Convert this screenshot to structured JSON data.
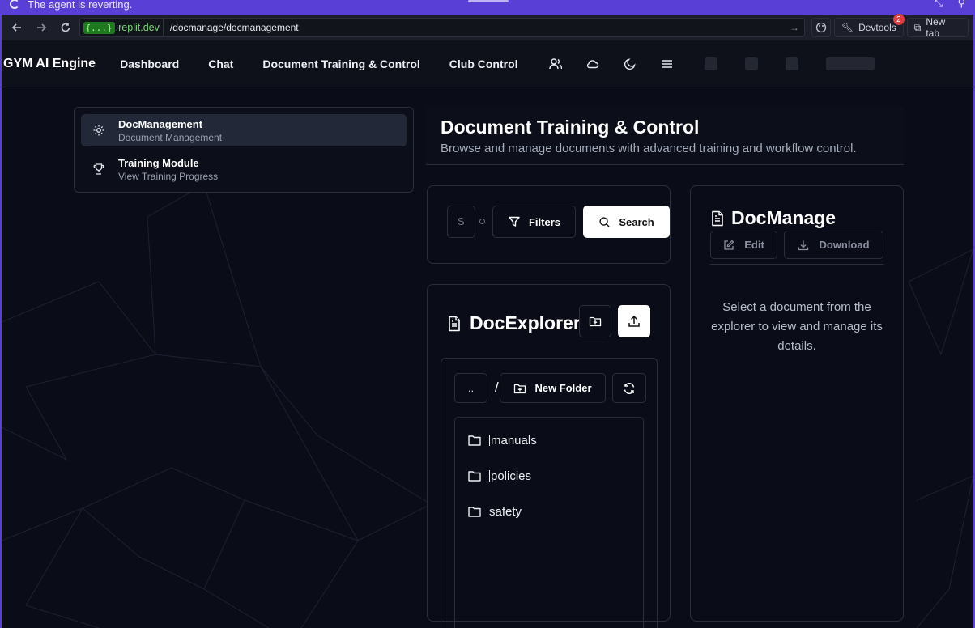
{
  "agent_banner": {
    "message": "The agent is reverting."
  },
  "browser": {
    "url_tag": "{...}",
    "url_domain": ".replit.dev",
    "url_path": "/docmanage/docmanagement",
    "devtools_label": "Devtools",
    "devtools_badge": "2",
    "new_tab_label": "New tab"
  },
  "app_nav": {
    "brand": "GYM AI Engine",
    "links": [
      "Dashboard",
      "Chat",
      "Document Training & Control",
      "Club Control"
    ],
    "icons": [
      "users-icon",
      "cloud-icon",
      "moon-icon",
      "menu-icon"
    ]
  },
  "sidebar": {
    "items": [
      {
        "title": "DocManagement",
        "subtitle": "Document Management",
        "icon": "gear-icon",
        "active": true
      },
      {
        "title": "Training Module",
        "subtitle": "View Training Progress",
        "icon": "trophy-icon",
        "active": false
      }
    ]
  },
  "page": {
    "title": "Document Training & Control",
    "subtitle": "Browse and manage documents with advanced training and workflow control."
  },
  "search": {
    "input_value": "S",
    "filters_label": "Filters",
    "search_label": "Search"
  },
  "explorer": {
    "title": "DocExplorer",
    "parent_label": "..",
    "path_sep": "/",
    "new_folder_label": "New Folder",
    "folders": [
      "manuals",
      "policies",
      "safety"
    ]
  },
  "doc_panel": {
    "title": "DocManage",
    "edit_label": "Edit",
    "download_label": "Download",
    "empty_message": "Select a document from the explorer to view and manage its details."
  },
  "colors": {
    "accent_frame": "#5a3fd6",
    "background": "#0a0d17",
    "card_border": "#2a2f3e",
    "badge": "#e23b3b"
  }
}
